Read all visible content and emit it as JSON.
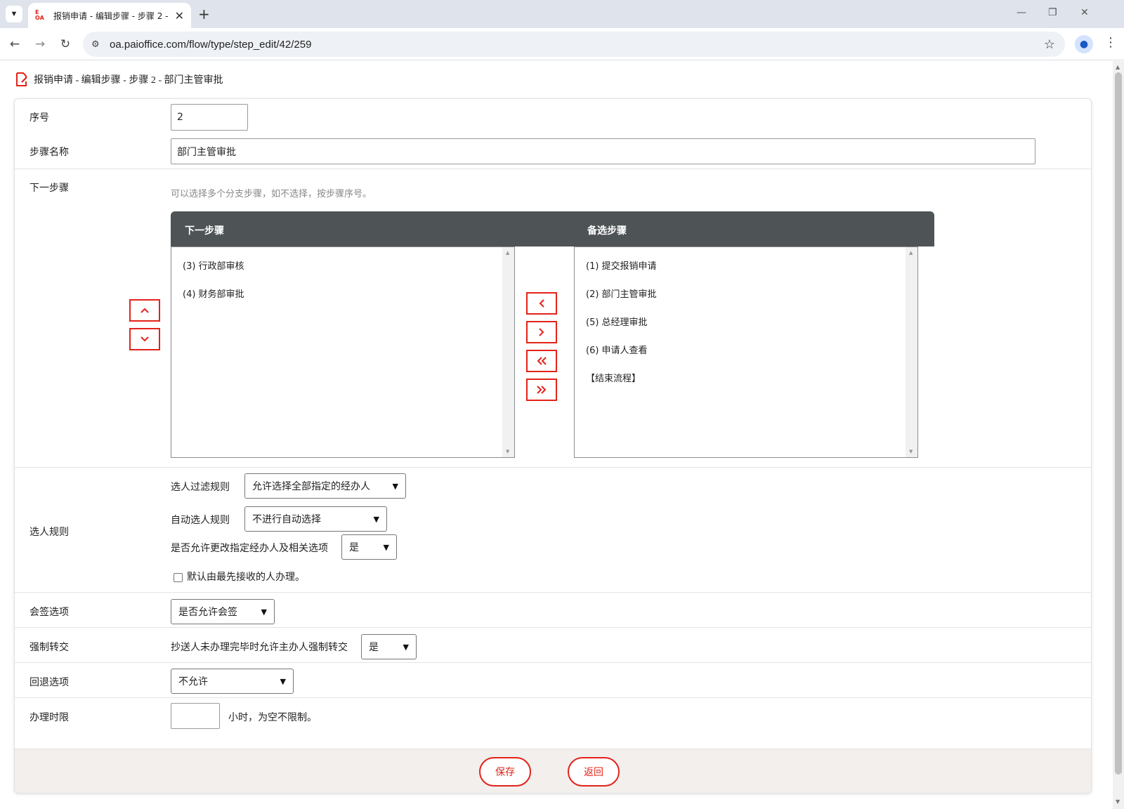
{
  "browser": {
    "tab_title": "报销申请 - 编辑步骤 - 步骤 2 -",
    "favicon_text_top": "E",
    "favicon_text_bottom": "OA",
    "url": "oa.paioffice.com/flow/type/step_edit/42/259"
  },
  "page": {
    "title": "报销申请 - 编辑步骤 - 步骤 2 - 部门主管审批"
  },
  "form": {
    "seq": {
      "label": "序号",
      "value": "2"
    },
    "step_name": {
      "label": "步骤名称",
      "value": "部门主管审批"
    },
    "next_step": {
      "label": "下一步骤",
      "hint": "可以选择多个分支步骤，如不选择，按步骤序号。",
      "selected_header": "下一步骤",
      "available_header": "备选步骤",
      "selected_items": [
        "(3) 行政部审核",
        "(4) 财务部审批"
      ],
      "available_items": [
        "(1) 提交报销申请",
        "(2) 部门主管审批",
        "(5) 总经理审批",
        "(6) 申请人查看",
        "【结束流程】"
      ],
      "buttons": {
        "up": "^",
        "down": "v",
        "move_left": "<",
        "move_right": ">",
        "move_all_left": "«",
        "move_all_right": "»"
      }
    },
    "selection_rules": {
      "label": "选人规则",
      "filter_label": "选人过滤规则",
      "filter_value": "允许选择全部指定的经办人",
      "auto_label": "自动选人规则",
      "auto_value": "不进行自动选择",
      "allow_change_label": "是否允许更改指定经办人及相关选项",
      "allow_change_value": "是",
      "default_first_label": "默认由最先接收的人办理。",
      "default_first_checked": false
    },
    "countersign": {
      "label": "会签选项",
      "value": "是否允许会签"
    },
    "force_transfer": {
      "label": "强制转交",
      "text": "抄送人未办理完毕时允许主办人强制转交",
      "value": "是"
    },
    "rollback": {
      "label": "回退选项",
      "value": "不允许"
    },
    "time_limit": {
      "label": "办理时限",
      "value": "",
      "suffix": "小时，为空不限制。"
    }
  },
  "actions": {
    "save": "保存",
    "back": "返回"
  },
  "colors": {
    "accent": "#e2231a",
    "header_dark": "#4e5356",
    "footer_bg": "#f2efed"
  }
}
